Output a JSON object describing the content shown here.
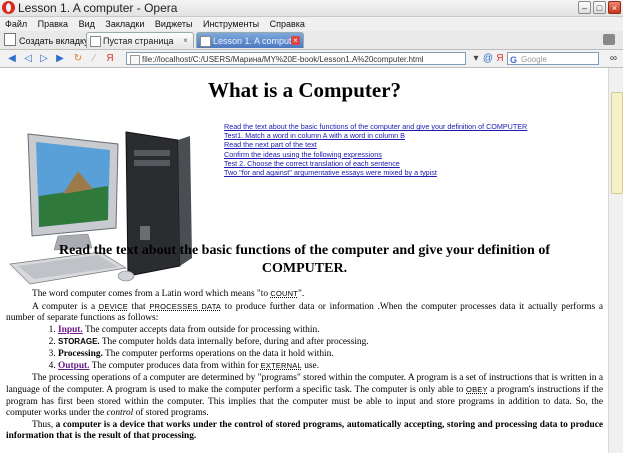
{
  "window": {
    "title": "Lesson 1. A computer - Opera"
  },
  "menu": [
    "Файл",
    "Правка",
    "Вид",
    "Закладки",
    "Виджеты",
    "Инструменты",
    "Справка"
  ],
  "tabs": {
    "new_tab_label": "Создать вкладку",
    "items": [
      {
        "label": "Пустая страница",
        "active": false
      },
      {
        "label": "Lesson 1. A computer",
        "active": true
      }
    ]
  },
  "address": {
    "url": "file://localhost/C:/USERS/Марина/MY%20E-book/Lesson1.A%20computer.html",
    "search_placeholder": "Google"
  },
  "page": {
    "title": "What is a Computer?",
    "links": [
      "Read the text about the basic functions of the computer and give your definition of COMPUTER",
      "Test1. Match a word in column A with a word in column B",
      "Read the next part of the text",
      "Confirm the ideas using the following expressions",
      "Test 2. Choose the correct translation of each sentence",
      "Two \"for and against\" argumentative essays were mixed by a typist"
    ],
    "section_heading": "Read the text about the basic functions of the computer and give your definition of COMPUTER.",
    "p1": {
      "a": "The word computer comes from a Latin word which means \"to ",
      "kw": "COUNT",
      "b": "\"."
    },
    "p2": {
      "a": "A computer is a ",
      "kw1": "DEVICE",
      "b": " that ",
      "kw2": "PROCESSES DATA",
      "c": " to produce further data or information .When the computer processes data it actually performs a number of separate functions as follows:"
    },
    "functions": [
      {
        "term": "Input.",
        "text": " The computer accepts data from outside  for processing within.",
        "style": "link"
      },
      {
        "term": "STORAGE.",
        "text": " The computer holds data internally before, during and after processing.",
        "style": "caps"
      },
      {
        "term": "Processing.",
        "text": " The computer performs operations on the data it hold within.",
        "style": "bold"
      },
      {
        "term": "Output.",
        "text": " The computer produces data from within for ",
        "kw": "EXTERNAL",
        "tail": " use.",
        "style": "link"
      }
    ],
    "p3": {
      "a": "The processing operations of a computer are determined by \"programs\" stored within the computer. A program is a set of instructions that is written in a language of the computer. A program is used to make the computer perform a specific task. The computer is only able to ",
      "kw1": "OBEY",
      "b": " a program's instructions if the program has first been stored within the computer. This implies that the computer must be able to input and store programs in addition to data. So, the computer works under the ",
      "kw2": "control",
      "c": " of stored programs."
    },
    "p4": {
      "a": "Thus, ",
      "b": "a computer is a device that works under the control of stored programs, automatically accepting, storing and processing data to produce information that is the result of that processing."
    }
  },
  "icons": {
    "app": "opera-logo-icon",
    "back": "back-arrow-icon",
    "forward": "forward-arrow-icon",
    "reload": "reload-icon",
    "wand": "wand-icon",
    "yandex": "yandex-icon",
    "search": "google-icon",
    "zoom": "glasses-icon"
  },
  "colors": {
    "link": "#1a1ab0",
    "visited_keyword": "#6a1a8a",
    "scroll_thumb": "#f5f0c6"
  }
}
